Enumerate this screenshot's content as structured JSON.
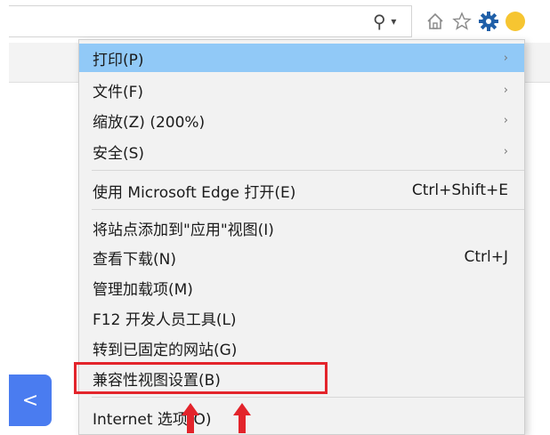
{
  "toolbar": {
    "search_icon": "search-icon",
    "dropdown_icon": "chevron-down-icon",
    "icons": [
      "home-icon",
      "star-icon",
      "gear-icon",
      "smiley-icon"
    ]
  },
  "menu": {
    "items": [
      {
        "label": "打印(P)",
        "shortcut": "",
        "arrow": "›"
      },
      {
        "label": "文件(F)",
        "shortcut": "",
        "arrow": "›"
      },
      {
        "label": "缩放(Z) (200%)",
        "shortcut": "",
        "arrow": "›"
      },
      {
        "label": "安全(S)",
        "shortcut": "",
        "arrow": "›"
      },
      {
        "label": "使用 Microsoft Edge 打开(E)",
        "shortcut": "Ctrl+Shift+E",
        "arrow": ""
      },
      {
        "label": "将站点添加到\"应用\"视图(I)",
        "shortcut": "",
        "arrow": ""
      },
      {
        "label": "查看下载(N)",
        "shortcut": "Ctrl+J",
        "arrow": ""
      },
      {
        "label": "管理加载项(M)",
        "shortcut": "",
        "arrow": ""
      },
      {
        "label": "F12 开发人员工具(L)",
        "shortcut": "",
        "arrow": ""
      },
      {
        "label": "转到已固定的网站(G)",
        "shortcut": "",
        "arrow": ""
      },
      {
        "label": "兼容性视图设置(B)",
        "shortcut": "",
        "arrow": ""
      },
      {
        "label": "Internet 选项(O)",
        "shortcut": "",
        "arrow": ""
      }
    ]
  },
  "side_button": {
    "glyph": "<"
  },
  "colors": {
    "highlight": "#91c9f7",
    "annotation": "#e3242b",
    "gear": "#1f5fa8",
    "side_button": "#4a7cf0"
  }
}
